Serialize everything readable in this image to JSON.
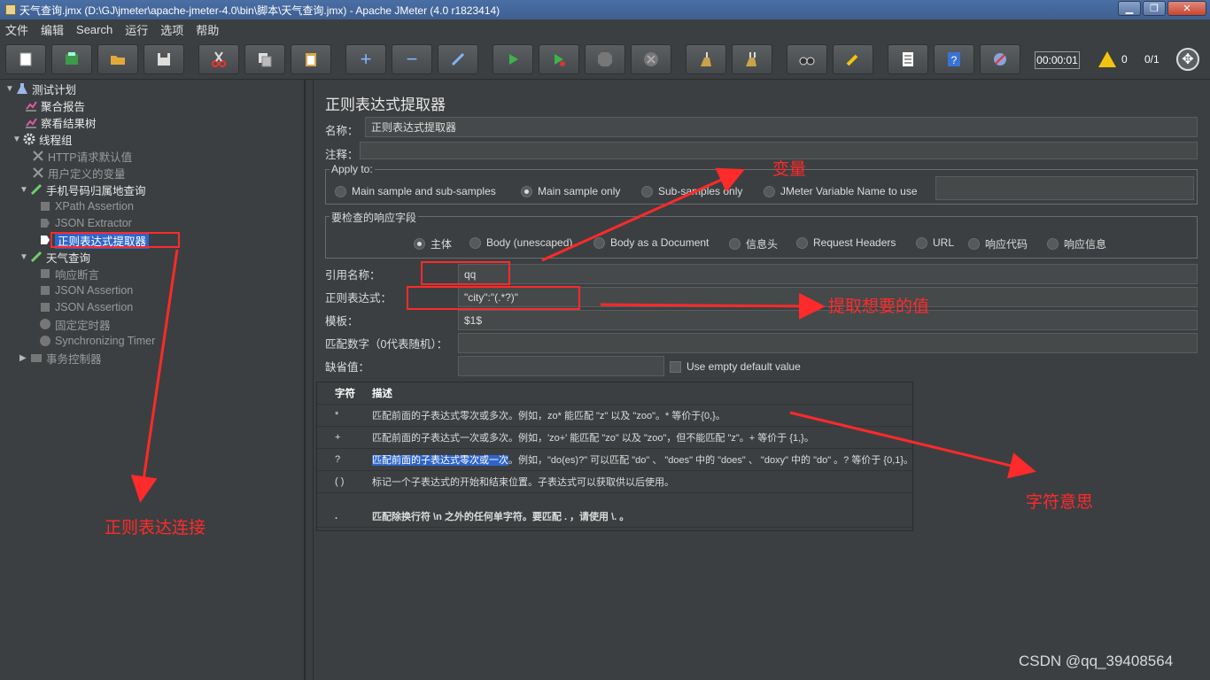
{
  "window": {
    "title": "天气查询.jmx (D:\\GJ\\jmeter\\apache-jmeter-4.0\\bin\\脚本\\天气查询.jmx) - Apache JMeter (4.0 r1823414)",
    "buttons": [
      "▁",
      "❐",
      "✕"
    ]
  },
  "menu": [
    "文件",
    "编辑",
    "Search",
    "运行",
    "选项",
    "帮助"
  ],
  "toolbar": {
    "buttons": [
      "new",
      "templates",
      "open",
      "save",
      "cut",
      "copy",
      "paste",
      "expand",
      "collapse",
      "toggle",
      "start",
      "start-no-pauses",
      "stop",
      "shutdown",
      "clear",
      "clear-all",
      "search",
      "reset-search",
      "function-helper",
      "help",
      "remote"
    ],
    "timer": "00:00:01",
    "warnings": "0",
    "threads": "0/1"
  },
  "tree": {
    "items": [
      {
        "label": "测试计划",
        "icon": "flask-icon"
      },
      {
        "label": "聚合报告",
        "icon": "chart-icon"
      },
      {
        "label": "察看结果树",
        "icon": "chart-icon"
      },
      {
        "label": "线程组",
        "icon": "gear-icon"
      },
      {
        "label": "HTTP请求默认值",
        "icon": "wrench-icon"
      },
      {
        "label": "用户定义的变量",
        "icon": "wrench-icon"
      },
      {
        "label": "手机号码归属地查询",
        "icon": "pen-icon"
      },
      {
        "label": "XPath Assertion",
        "icon": "assertion-icon"
      },
      {
        "label": "JSON Extractor",
        "icon": "extractor-icon"
      },
      {
        "label": "正则表达式提取器",
        "icon": "extractor-icon"
      },
      {
        "label": "天气查询",
        "icon": "pen-icon"
      },
      {
        "label": "响应断言",
        "icon": "assertion-icon"
      },
      {
        "label": "JSON Assertion",
        "icon": "assertion-icon"
      },
      {
        "label": "JSON Assertion",
        "icon": "assertion-icon"
      },
      {
        "label": "固定定时器",
        "icon": "timer-icon"
      },
      {
        "label": "Synchronizing Timer",
        "icon": "timer-icon"
      },
      {
        "label": "事务控制器",
        "icon": "controller-icon"
      }
    ]
  },
  "panel": {
    "title": "正则表达式提取器",
    "name_label": "名称：",
    "name_value": "正则表达式提取器",
    "comment_label": "注释：",
    "apply_to": {
      "legend": "Apply to:",
      "options": [
        "Main sample and sub-samples",
        "Main sample only",
        "Sub-samples only",
        "JMeter Variable Name to use"
      ],
      "selected": "Main sample only"
    },
    "field_to_check": {
      "legend": "要检查的响应字段",
      "options": [
        "主体",
        "Body (unescaped)",
        "Body as a Document",
        "信息头",
        "Request Headers",
        "URL",
        "响应代码",
        "响应信息"
      ],
      "selected": "主体"
    },
    "ref_name_label": "引用名称：",
    "ref_name_value": "qq",
    "regex_label": "正则表达式：",
    "regex_value": "\"city\":\"(.*?)\"",
    "template_label": "模板：",
    "template_value": "$1$",
    "match_no_label": "匹配数字（0代表随机）：",
    "match_no_value": "",
    "default_label": "缺省值：",
    "default_value": "",
    "use_empty_label": "Use empty default value"
  },
  "help_table": {
    "headers": [
      "字符",
      "描述"
    ],
    "rows": [
      {
        "char": "*",
        "desc": "匹配前面的子表达式零次或多次。例如，zo* 能匹配 \"z\" 以及 \"zoo\"。* 等价于{0,}。"
      },
      {
        "char": "+",
        "desc": "匹配前面的子表达式一次或多次。例如，'zo+' 能匹配 \"zo\" 以及 \"zoo\"，但不能匹配 \"z\"。+ 等价于 {1,}。"
      },
      {
        "char": "?",
        "desc_highlight": "匹配前面的子表达式零次或一次",
        "desc": "。例如，\"do(es)?\" 可以匹配 \"do\" 、 \"does\" 中的 \"does\" 、 \"doxy\" 中的 \"do\" 。? 等价于 {0,1}。"
      },
      {
        "char": "( )",
        "desc": "标记一个子表达式的开始和结束位置。子表达式可以获取供以后使用。"
      },
      {
        "char": ".",
        "desc": "匹配除换行符 \\n 之外的任何单字符。要匹配 . ，请使用 \\. 。"
      }
    ]
  },
  "annotations": {
    "variable": "变量",
    "extract": "提取想要的值",
    "char_meaning": "字符意思",
    "regex_link": "正则表达连接"
  },
  "watermark": "CSDN @qq_39408564",
  "colors": {
    "annotation": "#ff2a2a",
    "selection": "#2f65ca",
    "background": "#3c3f41"
  }
}
